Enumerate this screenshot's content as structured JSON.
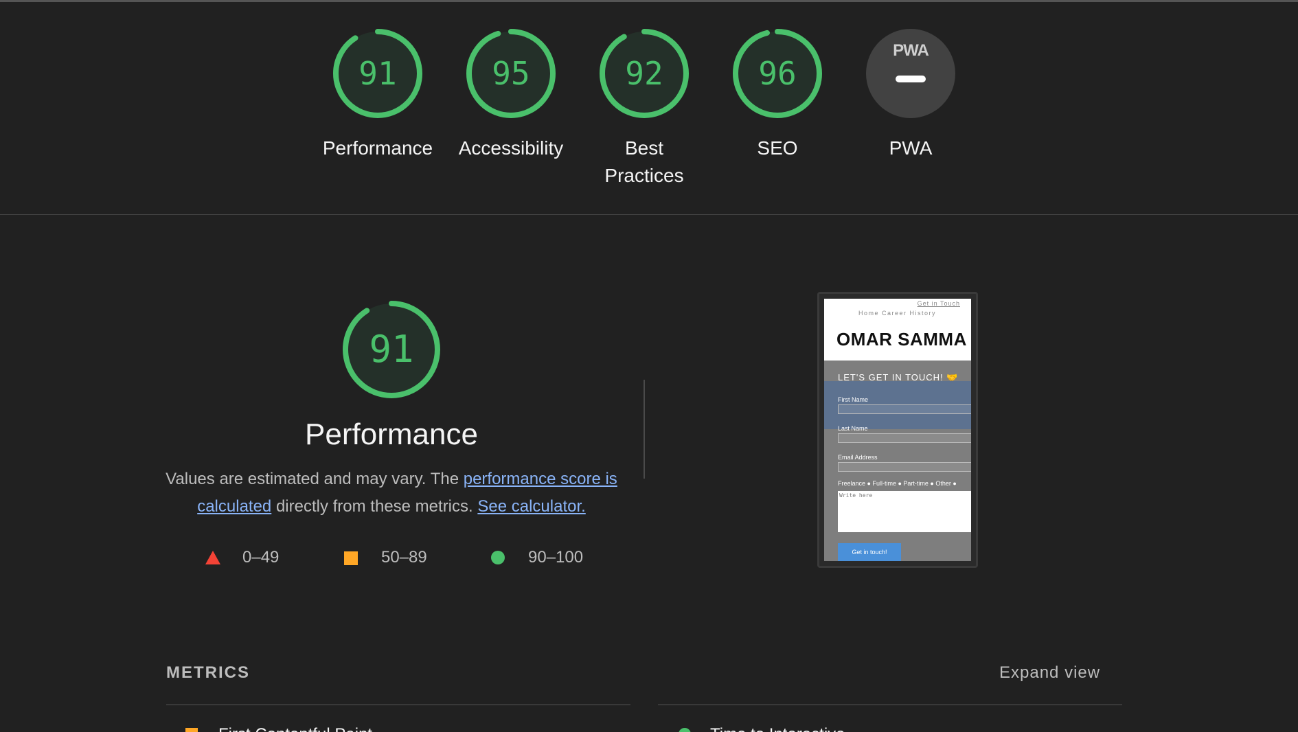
{
  "gauges": [
    {
      "score": "91",
      "label": "Performance",
      "fraction": 0.91
    },
    {
      "score": "95",
      "label": "Accessibility",
      "fraction": 0.95
    },
    {
      "score": "92",
      "label": "Best Practices",
      "fraction": 0.92
    },
    {
      "score": "96",
      "label": "SEO",
      "fraction": 0.96
    }
  ],
  "pwa": {
    "badge_text": "PWA",
    "label": "PWA"
  },
  "performance": {
    "score": "91",
    "fraction": 0.91,
    "title": "Performance",
    "desc_prefix": "Values are estimated and may vary. The ",
    "desc_link1": "performance score is calculated",
    "desc_middle": " directly from these metrics. ",
    "desc_link2": "See calculator."
  },
  "legend": [
    {
      "range": "0–49",
      "shape": "triangle",
      "color": "#f44336"
    },
    {
      "range": "50–89",
      "shape": "square",
      "color": "#ffa726"
    },
    {
      "range": "90–100",
      "shape": "circle",
      "color": "#4ac06b"
    }
  ],
  "thumbnail": {
    "nav_link": "Get in Touch",
    "nav_items": "Home    Career History",
    "name": "OMAR SAMMA",
    "form_heading": "LET'S GET IN TOUCH! 🤝",
    "first_name": "First Name",
    "last_name": "Last Name",
    "email": "Email Address",
    "radios": "Freelance ● Full-time ● Part-time ● Other ●",
    "textarea_placeholder": "Write here",
    "button": "Get in touch!"
  },
  "metrics": {
    "title": "METRICS",
    "expand": "Expand view",
    "first_left": "First Contentful Paint",
    "first_right": "Time to Interactive"
  },
  "colors": {
    "pass": "#4ac06b",
    "average": "#ffa726",
    "fail": "#f44336",
    "link": "#8ab4f8"
  }
}
